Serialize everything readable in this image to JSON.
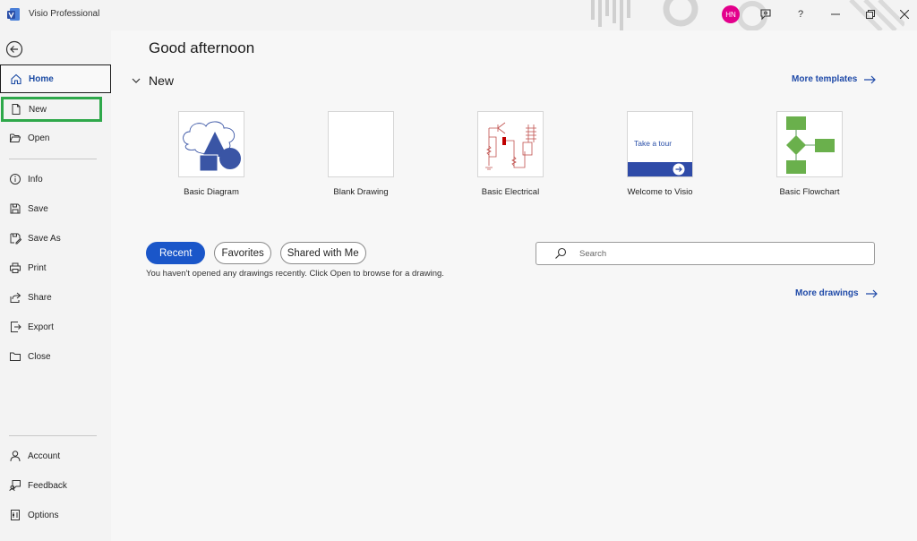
{
  "app": {
    "title": "Visio Professional",
    "user_initials": "HN"
  },
  "sidebar": {
    "items": [
      {
        "label": "Home",
        "icon": "home-icon"
      },
      {
        "label": "New",
        "icon": "new-file-icon"
      },
      {
        "label": "Open",
        "icon": "folder-open-icon"
      },
      {
        "label": "Info",
        "icon": "info-icon"
      },
      {
        "label": "Save",
        "icon": "save-icon"
      },
      {
        "label": "Save As",
        "icon": "save-as-icon"
      },
      {
        "label": "Print",
        "icon": "print-icon"
      },
      {
        "label": "Share",
        "icon": "share-icon"
      },
      {
        "label": "Export",
        "icon": "export-icon"
      },
      {
        "label": "Close",
        "icon": "close-folder-icon"
      },
      {
        "label": "Account",
        "icon": "person-icon"
      },
      {
        "label": "Feedback",
        "icon": "feedback-icon"
      },
      {
        "label": "Options",
        "icon": "options-icon"
      }
    ]
  },
  "main": {
    "greeting": "Good afternoon",
    "new_section": "New",
    "more_templates": "More templates",
    "templates": [
      {
        "label": "Basic Diagram"
      },
      {
        "label": "Blank Drawing"
      },
      {
        "label": "Basic Electrical"
      },
      {
        "label": "Welcome to Visio",
        "thumb_text": "Take a tour"
      },
      {
        "label": "Basic Flowchart"
      }
    ],
    "tabs": [
      "Recent",
      "Favorites",
      "Shared with Me"
    ],
    "search_placeholder": "Search",
    "empty_message": "You haven't opened any drawings recently. Click Open to browse for a drawing.",
    "more_drawings": "More drawings"
  },
  "colors": {
    "accent": "#1a56c9",
    "avatar": "#e3008c",
    "highlight": "#2ea84a",
    "diagram_blue": "#3a55a5",
    "flowchart_green": "#6ab04c"
  }
}
